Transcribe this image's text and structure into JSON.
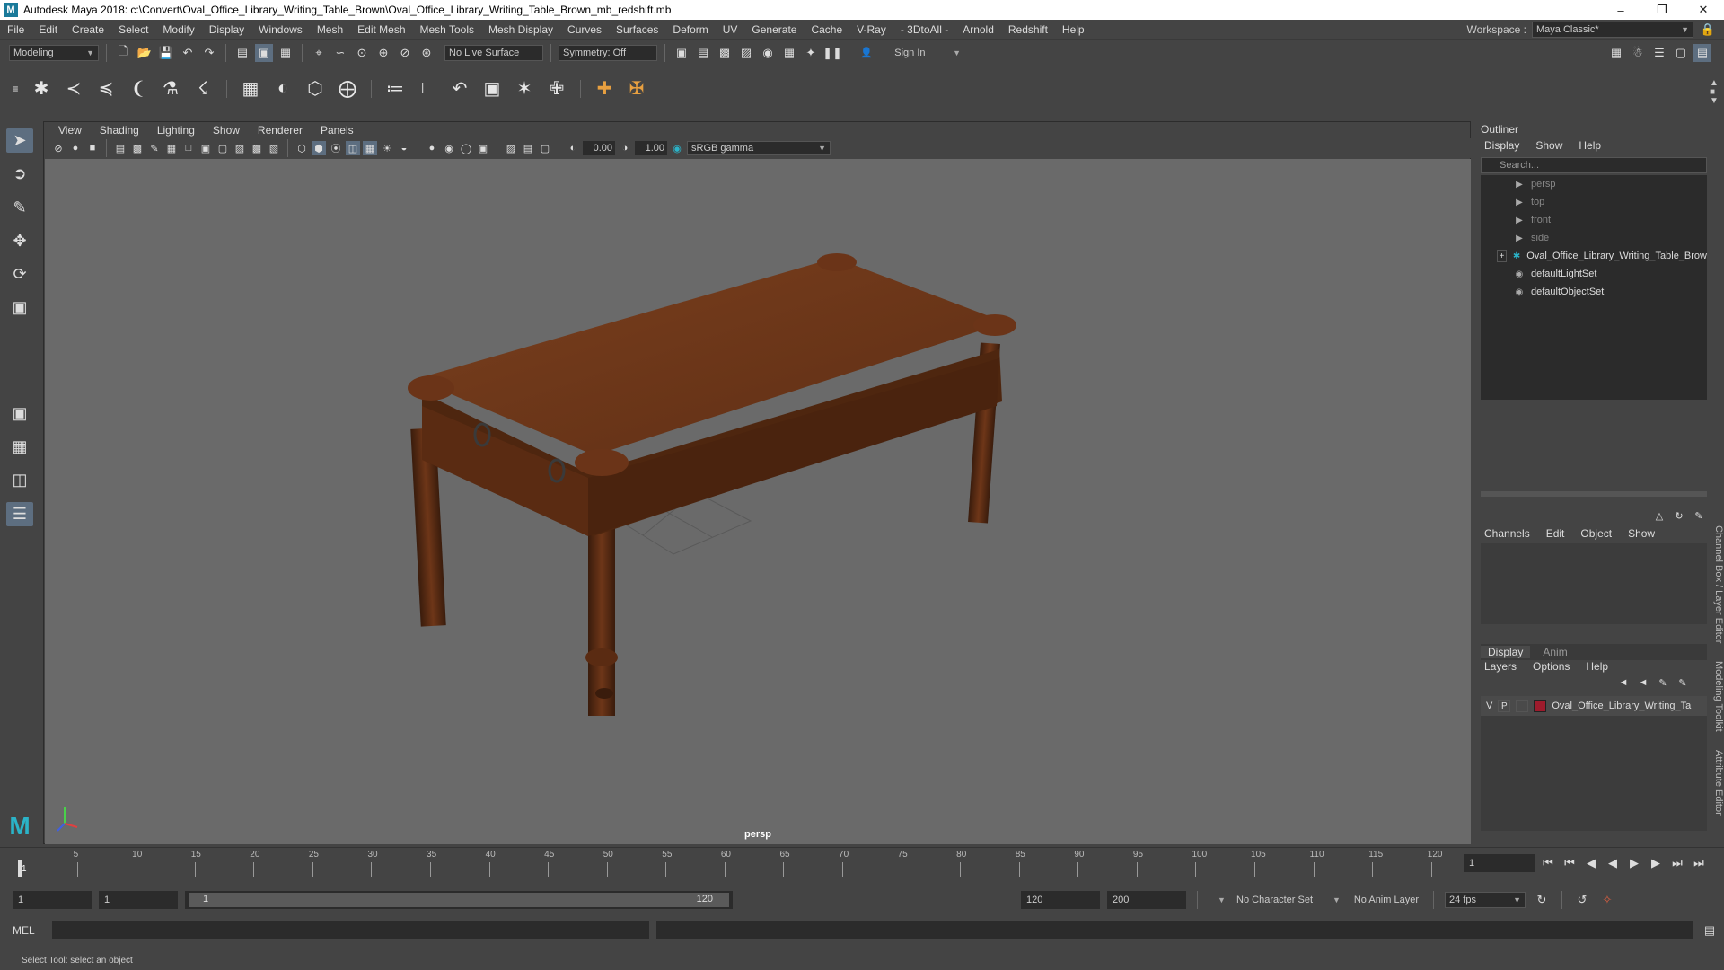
{
  "window": {
    "title": "Autodesk Maya 2018: c:\\Convert\\Oval_Office_Library_Writing_Table_Brown\\Oval_Office_Library_Writing_Table_Brown_mb_redshift.mb",
    "logo": "M"
  },
  "menubar": {
    "items": [
      "File",
      "Edit",
      "Create",
      "Select",
      "Modify",
      "Display",
      "Windows",
      "Mesh",
      "Edit Mesh",
      "Mesh Tools",
      "Mesh Display",
      "Curves",
      "Surfaces",
      "Deform",
      "UV",
      "Generate",
      "Cache",
      "V-Ray",
      "- 3DtoAll -",
      "Arnold",
      "Redshift",
      "Help"
    ],
    "workspace_label": "Workspace :",
    "workspace_value": "Maya Classic*"
  },
  "statusline": {
    "mode": "Modeling",
    "live_surface": "No Live Surface",
    "symmetry": "Symmetry: Off",
    "sign_in": "Sign In"
  },
  "viewport": {
    "menu": [
      "View",
      "Shading",
      "Lighting",
      "Show",
      "Renderer",
      "Panels"
    ],
    "exposure": "0.00",
    "gamma": "1.00",
    "color_space": "sRGB gamma",
    "camera_label": "persp"
  },
  "outliner": {
    "title": "Outliner",
    "menu": [
      "Display",
      "Show",
      "Help"
    ],
    "search_placeholder": "Search...",
    "items": [
      {
        "label": "persp",
        "type": "camera"
      },
      {
        "label": "top",
        "type": "camera"
      },
      {
        "label": "front",
        "type": "camera"
      },
      {
        "label": "side",
        "type": "camera"
      },
      {
        "label": "Oval_Office_Library_Writing_Table_Brow",
        "type": "group"
      },
      {
        "label": "defaultLightSet",
        "type": "set"
      },
      {
        "label": "defaultObjectSet",
        "type": "set"
      }
    ]
  },
  "channelbox": {
    "menu": [
      "Channels",
      "Edit",
      "Object",
      "Show"
    ]
  },
  "layers": {
    "tabs": [
      "Display",
      "Anim"
    ],
    "menu": [
      "Layers",
      "Options",
      "Help"
    ],
    "row": {
      "v": "V",
      "p": "P",
      "name": "Oval_Office_Library_Writing_Ta",
      "color": "#9d1b2c"
    }
  },
  "side_tabs": [
    "Channel Box / Layer Editor",
    "Modeling Toolkit",
    "Attribute Editor"
  ],
  "timeline": {
    "ticks": [
      "5",
      "10",
      "15",
      "20",
      "25",
      "30",
      "35",
      "40",
      "45",
      "50",
      "55",
      "60",
      "65",
      "70",
      "75",
      "80",
      "85",
      "90",
      "95",
      "100",
      "105",
      "110",
      "115",
      "120"
    ],
    "current_frame_marker": "1",
    "current_frame": "1"
  },
  "range": {
    "start": "1",
    "playback_start": "1",
    "slider_start": "1",
    "slider_end": "120",
    "playback_end": "120",
    "end": "200",
    "character_set": "No Character Set",
    "anim_layer": "No Anim Layer",
    "fps": "24 fps"
  },
  "cmdline": {
    "label": "MEL"
  },
  "helpline": {
    "text": "Select Tool: select an object"
  }
}
